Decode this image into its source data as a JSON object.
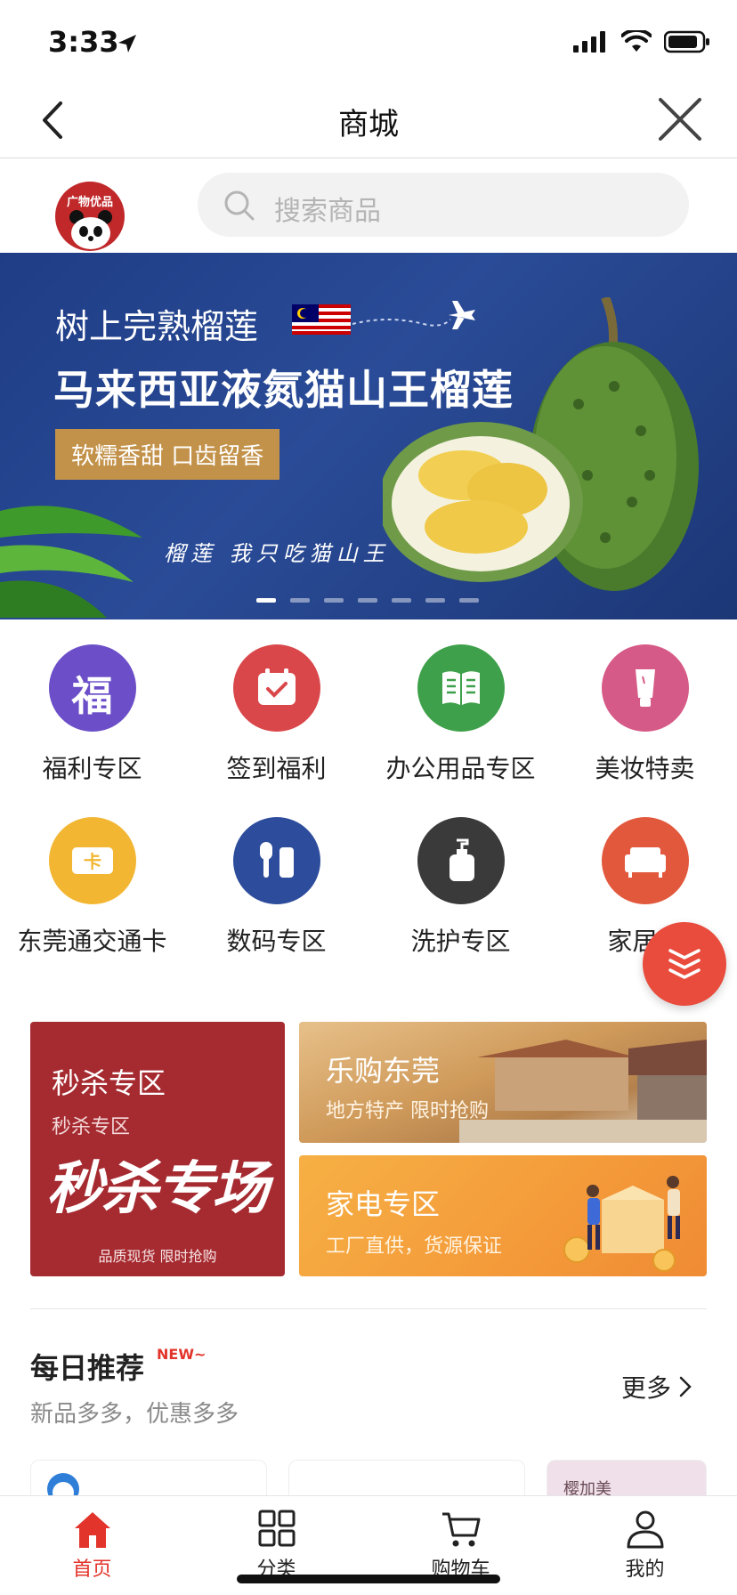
{
  "status_bar": {
    "time": "3:33"
  },
  "nav": {
    "title": "商城"
  },
  "search": {
    "logo_text": "广物优品",
    "placeholder": "搜索商品"
  },
  "banner": {
    "line1": "树上完熟榴莲",
    "line2": "马来西亚液氮猫山王榴莲",
    "badge": "软糯香甜 口齿留香",
    "slogan": "榴莲 我只吃猫山王",
    "page_count": 7,
    "active_page": 1
  },
  "categories": [
    {
      "label": "福利专区",
      "color": "#6c4fc8",
      "icon": "fu-icon"
    },
    {
      "label": "签到福利",
      "color": "#d9474a",
      "icon": "calendar-check-icon"
    },
    {
      "label": "办公用品专区",
      "color": "#3ea04a",
      "icon": "book-icon"
    },
    {
      "label": "美妆特卖",
      "color": "#d65a87",
      "icon": "cosmetics-icon"
    },
    {
      "label": "东莞通交通卡",
      "color": "#f2b632",
      "icon": "card-icon"
    },
    {
      "label": "数码专区",
      "color": "#2d4c9c",
      "icon": "earbuds-icon"
    },
    {
      "label": "洗护专区",
      "color": "#3a3a3a",
      "icon": "pump-bottle-icon"
    },
    {
      "label": "家居居",
      "color": "#e2583c",
      "icon": "sofa-icon"
    }
  ],
  "promos": {
    "seckill": {
      "title": "秒杀专区",
      "subtitle": "秒杀专区",
      "art_text": "秒杀专场",
      "footer": "品质现货 限时抢购"
    },
    "local": {
      "title": "乐购东莞",
      "subtitle": "地方特产 限时抢购"
    },
    "appliance": {
      "title": "家电专区",
      "subtitle": "工厂直供，货源保证"
    }
  },
  "daily": {
    "title": "每日推荐",
    "badge": "NEW~",
    "subtitle": "新品多多，优惠多多",
    "more": "更多"
  },
  "products_partial": [
    {
      "label": "樱加美"
    }
  ],
  "tabs": [
    {
      "label": "首页",
      "active": true
    },
    {
      "label": "分类",
      "active": false
    },
    {
      "label": "购物车",
      "active": false
    },
    {
      "label": "我的",
      "active": false
    }
  ],
  "colors": {
    "accent": "#e2342b",
    "banner_bg": "#1f3d86"
  }
}
